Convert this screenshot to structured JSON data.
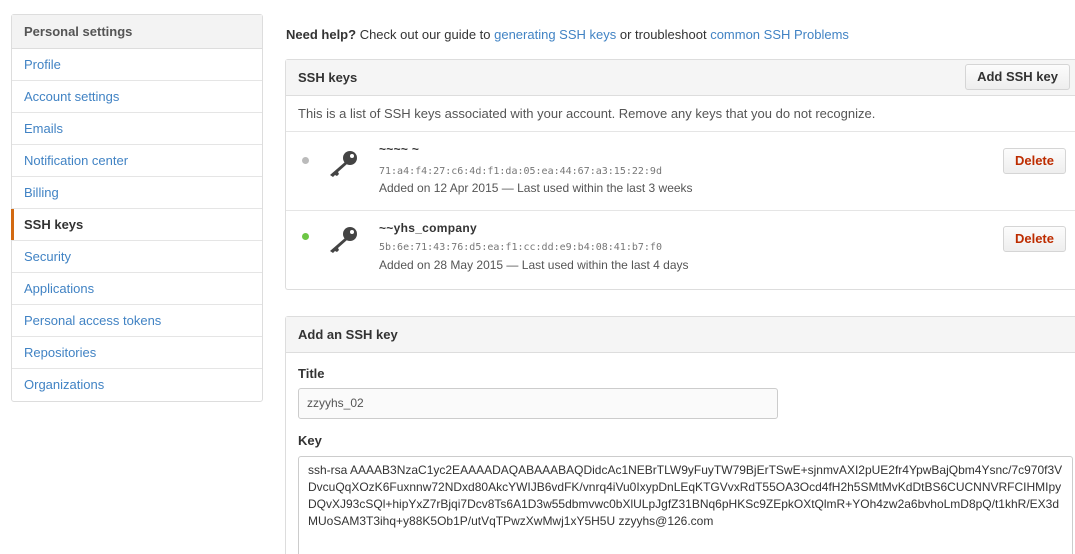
{
  "sidebar": {
    "header": "Personal settings",
    "items": [
      {
        "label": "Profile"
      },
      {
        "label": "Account settings"
      },
      {
        "label": "Emails"
      },
      {
        "label": "Notification center"
      },
      {
        "label": "Billing"
      },
      {
        "label": "SSH keys",
        "selected": true
      },
      {
        "label": "Security"
      },
      {
        "label": "Applications"
      },
      {
        "label": "Personal access tokens"
      },
      {
        "label": "Repositories"
      },
      {
        "label": "Organizations"
      }
    ]
  },
  "help": {
    "prefix_bold": "Need help?",
    "text1": " Check out our guide to ",
    "link1": "generating SSH keys",
    "text2": " or troubleshoot ",
    "link2": "common SSH Problems"
  },
  "ssh_keys": {
    "title": "SSH keys",
    "add_button": "Add SSH key",
    "intro": "This is a list of SSH keys associated with your account. Remove any keys that you do not recognize.",
    "keys": [
      {
        "title": "~~~~ ~",
        "fingerprint": "71:a4:f4:27:c6:4d:f1:da:05:ea:44:67:a3:15:22:9d",
        "added": "Added on 12 Apr 2015 — Last used within the last 3 weeks",
        "status_color": "#bbbbbb",
        "delete_label": "Delete"
      },
      {
        "title": "~~yhs_company",
        "fingerprint": "5b:6e:71:43:76:d5:ea:f1:cc:dd:e9:b4:08:41:b7:f0",
        "added": "Added on 28 May 2015 — Last used within the last 4 days",
        "status_color": "#6cc644",
        "delete_label": "Delete"
      }
    ]
  },
  "add_key": {
    "title": "Add an SSH key",
    "title_label": "Title",
    "title_value": "zzyyhs_02",
    "key_label": "Key",
    "key_value": "ssh-rsa AAAAB3NzaC1yc2EAAAADAQABAAABAQDidcAc1NEBrTLW9yFuyTW79BjErTSwE+sjnmvAXI2pUE2fr4YpwBajQbm4Ysnc/7c970f3VDvcuQqXOzK6Fuxnnw72NDxd80AkcYWIJB6vdFK/vnrq4iVu0IxypDnLEqKTGVvxRdT55OA3Ocd4fH2h5SMtMvKdDtBS6CUCNNVRFCIHMIpyDQvXJ93cSQl+hipYxZ7rBjqi7Dcv8Ts6A1D3w55dbmvwc0bXlULpJgfZ31BNq6pHKSc9ZEpkOXtQlmR+YOh4zw2a6bvhoLmD8pQ/t1khR/EX3dMUoSAM3T3ihq+y88K5Ob1P/utVqTPwzXwMwj1xY5H5U zzyyhs@126.com"
  },
  "colors": {
    "link": "#4183c4",
    "selected_accent": "#d26911",
    "danger": "#bd2c00"
  }
}
